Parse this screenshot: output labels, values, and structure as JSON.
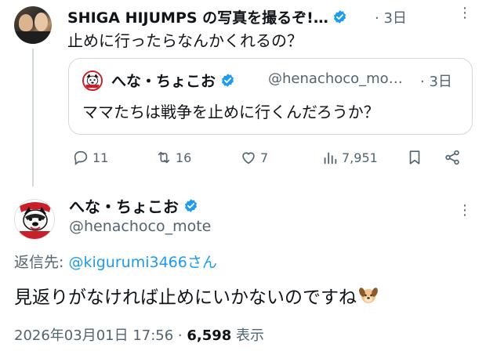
{
  "colors": {
    "verified": "#1d9bf0",
    "secondary_text": "#536471",
    "link": "#1d9bf0",
    "border": "#cfd9de",
    "brand_red": "#c8202a"
  },
  "tweet1": {
    "display_name": "SHIGA HIJUMPS の写真を撮るぞ!…",
    "time": "· 3日",
    "text": "止めに行ったらなんかくれるの？",
    "quote": {
      "display_name": "へな・ちょこお",
      "handle": "@henachoco_mo…",
      "time": "· 3日",
      "text": "ママたちは戦争を止めに行くんだろうか？"
    },
    "actions": {
      "reply_count": "11",
      "retweet_count": "16",
      "like_count": "7",
      "view_count": "7,951"
    }
  },
  "tweet2": {
    "display_name": "へな・ちょこお",
    "handle": "@henachoco_mote",
    "reply_label": "返信先: ",
    "reply_mention": "@kigurumi3466さん",
    "text": "見返りがなければ止めにいかないのですね",
    "timestamp": "2026年03月01日 17:56 · ",
    "views": "6,598",
    "views_label": " 表示"
  }
}
